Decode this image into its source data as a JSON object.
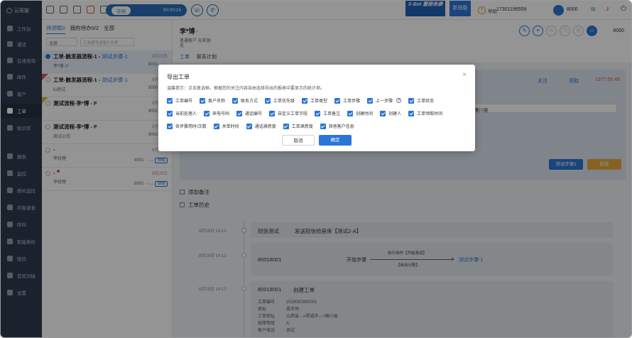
{
  "app": {
    "brand": "云客服"
  },
  "topbar": {
    "call_status": "空闲",
    "call_timer": "00:00:15",
    "banner_text": "X-Bot 重磅来袭",
    "banner2_text": "新技能",
    "help_label": "帮助",
    "phone": "17301196559",
    "agent_num": "8000"
  },
  "sidebar": {
    "items": [
      {
        "label": "工作台"
      },
      {
        "label": "通话"
      },
      {
        "label": "在线咨询"
      },
      {
        "label": "邮件"
      },
      {
        "label": "客户"
      },
      {
        "label": "工单"
      },
      {
        "label": "知识库"
      },
      {
        "label": "报表"
      },
      {
        "label": "监控"
      },
      {
        "label": "质检监控"
      },
      {
        "label": "问卷调查"
      },
      {
        "label": "呼叫"
      },
      {
        "label": "智能质检"
      },
      {
        "label": "短信"
      },
      {
        "label": "首页对接"
      },
      {
        "label": "设置"
      }
    ]
  },
  "ticketlist": {
    "tabs": [
      "待领取0",
      "我的待办0/2",
      "全部"
    ],
    "filter_select": "全部",
    "search_placeholder": "工单编号或客户名称",
    "items": [
      {
        "title": "工单-触发器流程-1 - ",
        "step": "测试步骤-1",
        "sub": "李*博-1*",
        "date": "8月28日",
        "id": "8001 ···→",
        "tag": ""
      },
      {
        "title": "工单-触发器流程-1 - ",
        "step": "测试步骤-1",
        "sub": "fu测试",
        "date": "8月28日",
        "id": "8000 ···→",
        "tag": ""
      },
      {
        "title": "测试流程-李*博 - F",
        "step": "",
        "sub": "",
        "date": "8月28日",
        "id": "8001 ···→",
        "tag": ""
      },
      {
        "title": "测试流程-李*博 - F",
        "step": "",
        "sub": "测试公司",
        "date": "8月28日",
        "id": "8001 ···→",
        "tag": ""
      },
      {
        "title": "- ",
        "step": "",
        "sub": "李经理",
        "date": "8月28日",
        "id": "8001 ···→",
        "tag": "领取"
      },
      {
        "title": "- ",
        "step": "",
        "sub": "李经理",
        "date": "8月28日",
        "id": "8001 ···→",
        "tag": "领取"
      }
    ]
  },
  "customer": {
    "name": "李*博",
    "name_suffix": "·*",
    "meta_line1": "普通客户   无来源",
    "meta_line2": "无",
    "tabs": [
      "工单",
      "联系计划"
    ],
    "avatar_num": "8000"
  },
  "workcard": {
    "follow": "关注",
    "take": "领取",
    "timer": "1977:00:45",
    "field_value": "睢川县",
    "next_step": "测试步骤1",
    "close": "结束"
  },
  "sections": {
    "add_note": "添加备注",
    "history": "工单历史"
  },
  "timeline": [
    {
      "time": "8月28日 14:13",
      "c1": "短信测试",
      "c2": "发送短信给座席【测试2-A】"
    },
    {
      "time": "8月28日 14:13",
      "c1": "80018001",
      "flow_start": "开始步骤",
      "flow_action": "执行动作【开始测试】",
      "flow_auto": "【自动分配】",
      "flow_end": "测试步骤-1"
    },
    {
      "time": "8月28日 14:13",
      "c1": "80018001",
      "c2": "创建工单",
      "details": [
        {
          "k": "工单编号",
          "v": "2019082800001"
        },
        {
          "k": "地址",
          "v": "菜市场"
        },
        {
          "k": "工单地址",
          "v": "山西省--->晋城市--->睢川县"
        },
        {
          "k": "故障等级",
          "v": "A"
        },
        {
          "k": "客户电话",
          "v": "测试"
        }
      ]
    }
  ],
  "modal": {
    "title": "导出工单",
    "hint": "温馨提示：点击复选框，根据您的关注内容自由选择导出的报表中要显示的统计项。",
    "row1": [
      "工单编号",
      "客户名称",
      "联系方式",
      "工单优先级",
      "工单类型",
      "工单步骤",
      "上一步骤",
      "工单状态"
    ],
    "row2": [
      "当前处理人",
      "来电号码",
      "通话编号",
      "自定义工单字段",
      "工单备注",
      "创建时间",
      "创建人",
      "工单领取时间"
    ],
    "row3": [
      "各步骤用时/次数",
      "关单时间",
      "通话满意度",
      "工单满意度",
      "其他客户信息"
    ],
    "cancel": "取消",
    "confirm": "确定"
  }
}
